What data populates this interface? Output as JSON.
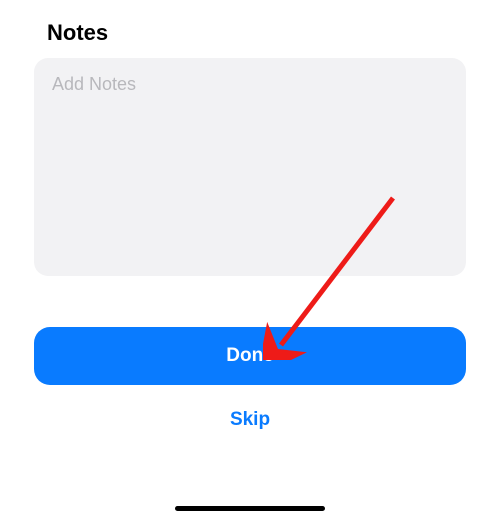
{
  "header": {
    "title": "Notes"
  },
  "notes": {
    "placeholder": "Add Notes",
    "value": ""
  },
  "buttons": {
    "done_label": "Done",
    "skip_label": "Skip"
  },
  "colors": {
    "primary": "#097bff",
    "text_area_bg": "#f2f2f4",
    "placeholder": "#b8b8bc"
  }
}
